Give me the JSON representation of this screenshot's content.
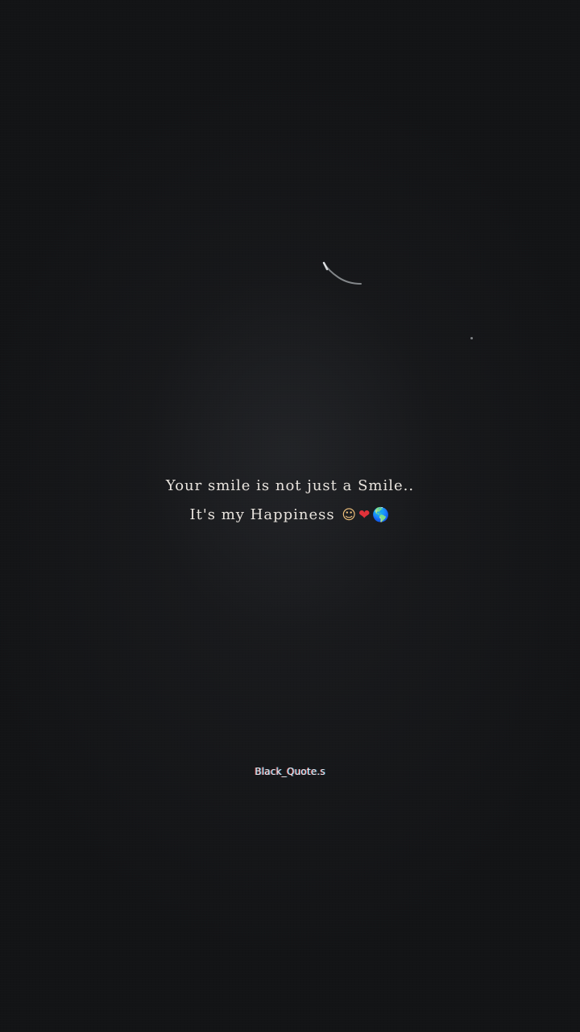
{
  "quote": {
    "line1": "Your smile is not just a Smile..",
    "line2": "It's my Happiness",
    "emojis": [
      {
        "name": "smiling-face-icon",
        "glyph": "☺"
      },
      {
        "name": "heart-icon",
        "glyph": "❤"
      },
      {
        "name": "globe-icon",
        "glyph": "🌎"
      }
    ]
  },
  "watermark": "Black_Quote.s",
  "colors": {
    "background": "#141517",
    "text": "#e9e4de"
  }
}
